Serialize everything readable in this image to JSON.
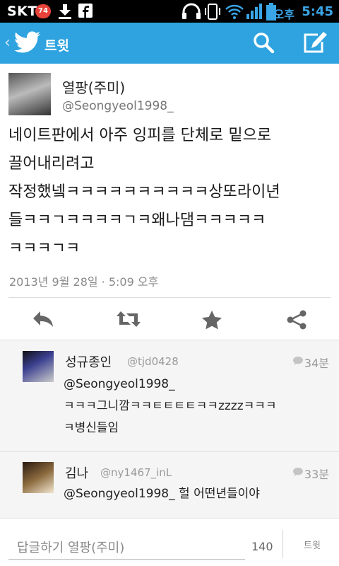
{
  "status_bar": {
    "carrier": "SKT",
    "badge": "74",
    "ampm": "오후",
    "time": "5:45",
    "icons": [
      "download-icon",
      "facebook-icon",
      "headset-icon",
      "vibrate-icon",
      "wifi-icon",
      "signal-icon",
      "battery-icon"
    ]
  },
  "topbar": {
    "title": "트윗",
    "color": "#2ea3e0",
    "icons": [
      "back-chevron-icon",
      "twitter-bird-icon",
      "search-icon",
      "compose-icon"
    ]
  },
  "tweet": {
    "author_name": "열팡(주미)",
    "author_handle": "@Seongyeol1998_",
    "text_lines": [
      "네이트판에서 아주 잉피를 단체로 밑으로",
      "끌어내리려고",
      "작정했넼ㅋㅋㅋㅋㅋㅋㅋㅋㅋㅋ상또라이년",
      "들ㅋㅋㄱㅋㅋㅋㅋㄱㅋ왜나댐ㅋㅋㅋㅋㅋ",
      "ㅋㅋㅋㄱㅋ"
    ],
    "timestamp": "2013년 9월 28일 · 5:09 오후"
  },
  "actions": [
    "reply-icon",
    "retweet-icon",
    "favorite-icon",
    "share-icon"
  ],
  "replies": [
    {
      "name": "성규종인",
      "handle": "@tjd0428",
      "time": "34분",
      "lines": [
        "@Seongyeol1998_",
        "ㅋㅋㅋ그니깜ㅋㅋㅌㅌㅌㅌㅋㅋzzzzㅋㅋㅋ",
        "ㅋ병신들임"
      ]
    },
    {
      "name": "김나",
      "handle": "@ny1467_inL",
      "time": "33분",
      "lines": [
        "@Seongyeol1998_ 헐 어떤년들이야"
      ]
    }
  ],
  "compose": {
    "placeholder": "답글하기 열팡(주미)",
    "count": "140",
    "send_label": "트윗"
  }
}
